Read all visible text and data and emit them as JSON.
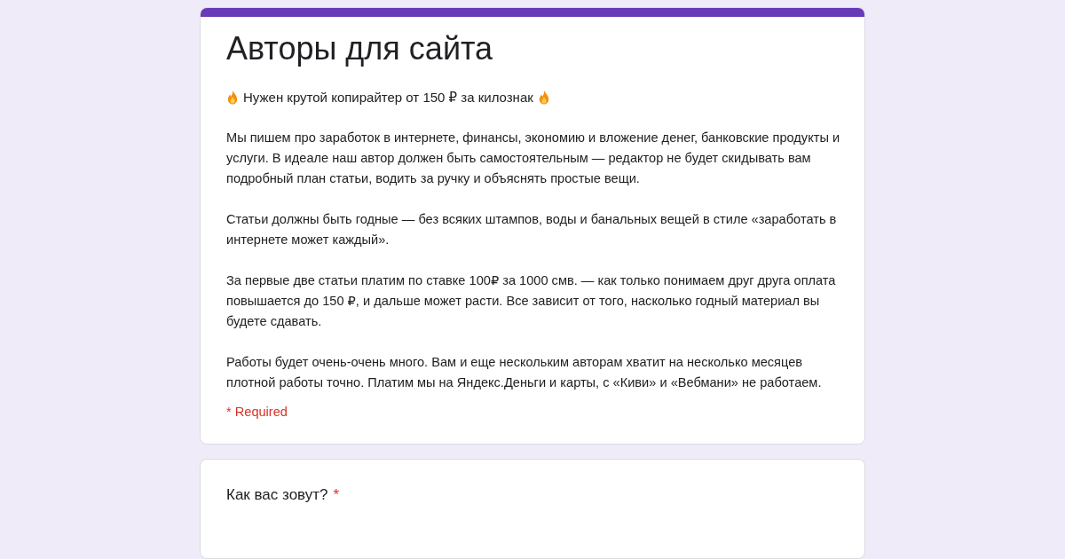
{
  "form": {
    "title": "Авторы для сайта",
    "headline": "Нужен крутой копирайтер от 150 ₽ за килознак",
    "paragraphs": [
      "Мы пишем про заработок в интернете, финансы, экономию и вложение денег, банковские продукты и услуги. В идеале наш автор должен быть самостоятельным — редактор не будет скидывать вам подробный план статьи, водить за ручку и объяснять простые вещи.",
      "Статьи должны быть годные — без всяких штампов, воды и банальных вещей в стиле «заработать в интернете может каждый».",
      "За первые две статьи платим по ставке 100₽ за 1000 смв. — как только понимаем друг друга оплата повышается до 150 ₽, и дальше может расти. Все зависит от того, насколько годный материал вы будете сдавать.",
      "Работы будет очень-очень много. Вам и еще нескольким авторам хватит на несколько месяцев плотной работы точно. Платим мы на Яндекс.Деньги и карты, с «Киви» и «Вебмани» не работаем."
    ],
    "required_note": "* Required"
  },
  "questions": [
    {
      "title": "Как вас зовут?",
      "required": true,
      "required_mark": "*"
    }
  ]
}
